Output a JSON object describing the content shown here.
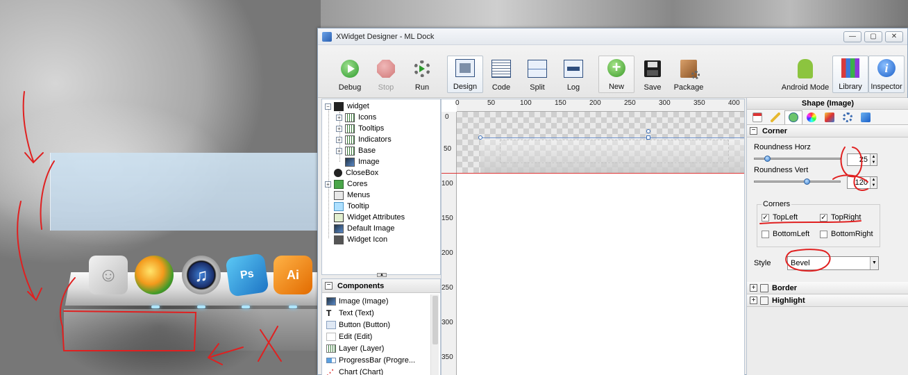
{
  "window": {
    "title": "XWidget Designer - ML Dock",
    "controls": [
      "—",
      "▢",
      "✕"
    ]
  },
  "toolbar": {
    "debug": "Debug",
    "stop": "Stop",
    "run": "Run",
    "design": "Design",
    "code": "Code",
    "split": "Split",
    "log": "Log",
    "new": "New",
    "save": "Save",
    "package": "Package",
    "android": "Android Mode",
    "library": "Library",
    "inspector": "Inspector"
  },
  "tree": {
    "items": [
      {
        "label": "widget",
        "expander": "−"
      },
      {
        "label": "Icons",
        "expander": "+"
      },
      {
        "label": "Tooltips",
        "expander": "+"
      },
      {
        "label": "Indicators",
        "expander": "+"
      },
      {
        "label": "Base",
        "expander": "+"
      },
      {
        "label": "Image",
        "expander": ""
      },
      {
        "label": "CloseBox",
        "expander": ""
      },
      {
        "label": "Cores",
        "expander": "+"
      },
      {
        "label": "Menus",
        "expander": ""
      },
      {
        "label": "Tooltip",
        "expander": ""
      },
      {
        "label": "Widget Attributes",
        "expander": ""
      },
      {
        "label": "Default Image",
        "expander": ""
      },
      {
        "label": "Widget Icon",
        "expander": ""
      }
    ]
  },
  "components": {
    "header": "Components",
    "items": [
      "Image (Image)",
      "Text (Text)",
      "Button (Button)",
      "Edit (Edit)",
      "Layer (Layer)",
      "ProgressBar (Progre...",
      "Chart (Chart)"
    ]
  },
  "canvas": {
    "ruler_x": [
      "0",
      "50",
      "100",
      "150",
      "200",
      "250",
      "300",
      "350",
      "400"
    ],
    "ruler_y": [
      "0",
      "50",
      "100",
      "150",
      "200",
      "250",
      "300",
      "350"
    ]
  },
  "inspector": {
    "title": "Shape (Image)",
    "corner_header": "Corner",
    "roundness_horz_label": "Roundness Horz",
    "roundness_horz_value": "25",
    "roundness_vert_label": "Roundness Vert",
    "roundness_vert_value": "120",
    "corners_group": "Corners",
    "topleft": "TopLeft",
    "topright": "TopRight",
    "bottomleft": "BottomLeft",
    "bottomright": "BottomRight",
    "check_mark": "✓",
    "style_label": "Style",
    "style_value": "Bevel",
    "border_header": "Border",
    "highlight_header": "Highlight"
  },
  "dock": {
    "ps_label": "Ps",
    "ai_label": "Ai",
    "itunes_label": "♫"
  },
  "colors": {
    "accent_red": "#e02020",
    "selection_blue": "#3b6fb8"
  }
}
